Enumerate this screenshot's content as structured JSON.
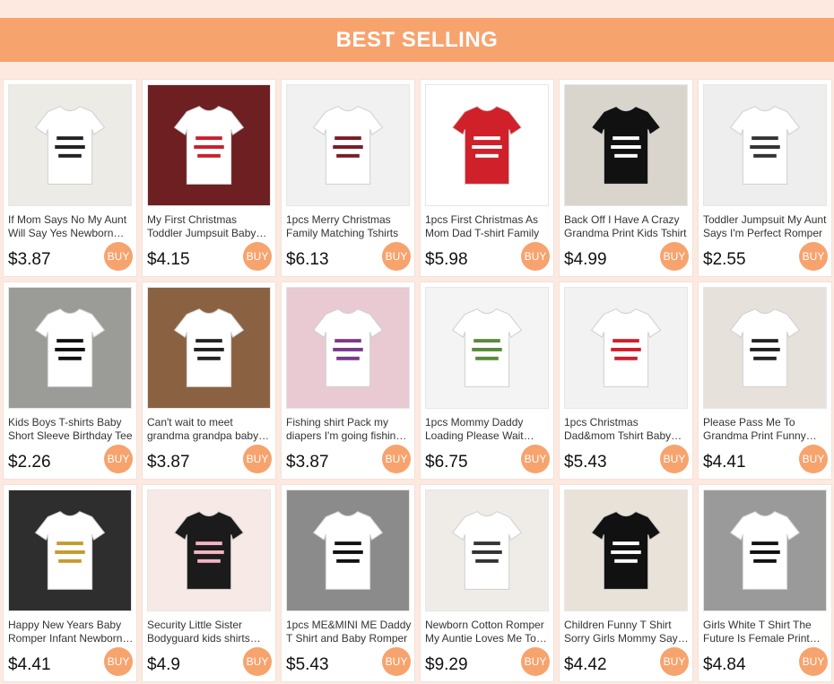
{
  "banner": {
    "title": "BEST SELLING"
  },
  "colors": {
    "accent": "#f7a36e",
    "background": "#fde9df"
  },
  "products": [
    {
      "title": "If Mom Says No My Aunt Will Say Yes Newborn Baby Romper",
      "price": "$3.87",
      "buy_label": "BUY",
      "image": "baby-onesie-white",
      "bg": "#ecebe6",
      "fg": "#ffffff",
      "ink": "#222222"
    },
    {
      "title": "My First Christmas Toddler Jumpsuit Baby Romper",
      "price": "$4.15",
      "buy_label": "BUY",
      "image": "christmas-onesies",
      "bg": "#6e1f22",
      "fg": "#ffffff",
      "ink": "#c8202b"
    },
    {
      "title": "1pcs Merry Christmas Family Matching Tshirts",
      "price": "$6.13",
      "buy_label": "BUY",
      "image": "family-christmas-shirts",
      "bg": "#f1f1f1",
      "fg": "#ffffff",
      "ink": "#7a1b25"
    },
    {
      "title": "1pcs First Christmas As Mom Dad T-shirt Family",
      "price": "$5.98",
      "buy_label": "BUY",
      "image": "red-christmas-tshirts",
      "bg": "#ffffff",
      "fg": "#d0202a",
      "ink": "#ffffff"
    },
    {
      "title": "Back Off I Have A Crazy Grandma Print Kids Tshirt",
      "price": "$4.99",
      "buy_label": "BUY",
      "image": "black-kid-tshirt",
      "bg": "#d9d5cc",
      "fg": "#111111",
      "ink": "#ffffff"
    },
    {
      "title": "Toddler Jumpsuit My Aunt Says I'm Perfect Romper",
      "price": "$2.55",
      "buy_label": "BUY",
      "image": "baby-aunt-romper",
      "bg": "#eeeeee",
      "fg": "#ffffff",
      "ink": "#333333"
    },
    {
      "title": "Kids Boys T-shirts Baby Short Sleeve Birthday Tee",
      "price": "$2.26",
      "buy_label": "BUY",
      "image": "birthday-tshirt",
      "bg": "#9b9b98",
      "fg": "#ffffff",
      "ink": "#111111"
    },
    {
      "title": "Can't wait to meet grandma grandpa baby announcement",
      "price": "$3.87",
      "buy_label": "BUY",
      "image": "announcement-onesies",
      "bg": "#8a6242",
      "fg": "#ffffff",
      "ink": "#222222"
    },
    {
      "title": "Fishing shirt Pack my diapers I'm going fishing with daddy",
      "price": "$3.87",
      "buy_label": "BUY",
      "image": "fishing-onesies",
      "bg": "#e9c9d2",
      "fg": "#ffffff",
      "ink": "#7a3b8c"
    },
    {
      "title": "1pcs Mommy Daddy Loading Please Wait Couple Tshirt",
      "price": "$6.75",
      "buy_label": "BUY",
      "image": "couple-tshirts",
      "bg": "#f4f4f4",
      "fg": "#ffffff",
      "ink": "#5a8a3a"
    },
    {
      "title": "1pcs Christmas Dad&mom Tshirt Baby Romper Family",
      "price": "$5.43",
      "buy_label": "BUY",
      "image": "dad-mom-christmas",
      "bg": "#f2f2f2",
      "fg": "#ffffff",
      "ink": "#d21e2a"
    },
    {
      "title": "Please Pass Me To Grandma Print Funny Baby Romper",
      "price": "$4.41",
      "buy_label": "BUY",
      "image": "grandma-romper",
      "bg": "#e7e1dc",
      "fg": "#ffffff",
      "ink": "#222222"
    },
    {
      "title": "Happy New Years Baby Romper Infant Newborn Bodysuit",
      "price": "$4.41",
      "buy_label": "BUY",
      "image": "new-year-romper",
      "bg": "#2e2e2e",
      "fg": "#ffffff",
      "ink": "#c79a2e"
    },
    {
      "title": "Security Little Sister Bodyguard kids shirts sibling",
      "price": "$4.9",
      "buy_label": "BUY",
      "image": "sibling-shirts",
      "bg": "#f6e9e6",
      "fg": "#1b1b1b",
      "ink": "#f4b4c2"
    },
    {
      "title": "1pcs ME&MINI ME Daddy T Shirt and Baby Romper",
      "price": "$5.43",
      "buy_label": "BUY",
      "image": "mini-me-shirts",
      "bg": "#8b8b8b",
      "fg": "#ffffff",
      "ink": "#111111"
    },
    {
      "title": "Newborn Cotton Romper My Auntie Loves Me To The Moon",
      "price": "$9.29",
      "buy_label": "BUY",
      "image": "moon-romper",
      "bg": "#efece8",
      "fg": "#ffffff",
      "ink": "#333333"
    },
    {
      "title": "Children Funny T Shirt Sorry Girls Mommy Says No Dating",
      "price": "$4.42",
      "buy_label": "BUY",
      "image": "sorry-girls-tshirt",
      "bg": "#e8e2d8",
      "fg": "#111111",
      "ink": "#ffffff"
    },
    {
      "title": "Girls White T Shirt The Future Is Female Print Tee",
      "price": "$4.84",
      "buy_label": "BUY",
      "image": "future-female-tshirt",
      "bg": "#9a9a9a",
      "fg": "#ffffff",
      "ink": "#111111"
    }
  ]
}
